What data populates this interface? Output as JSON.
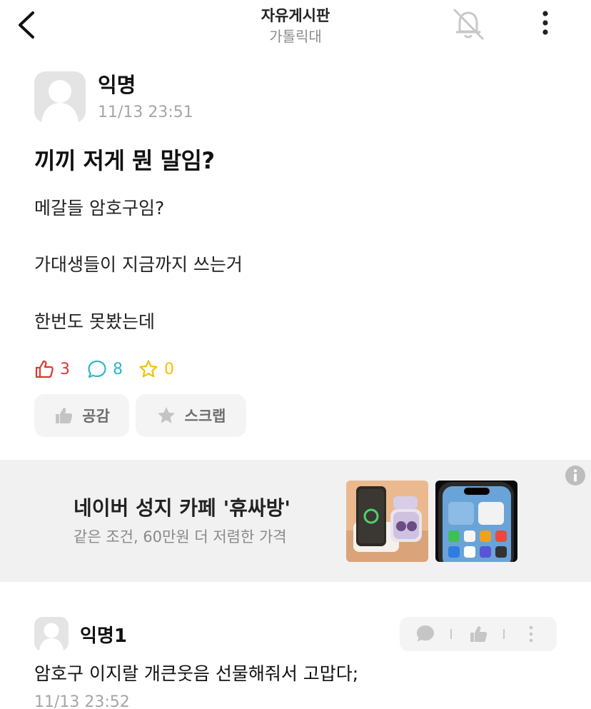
{
  "header": {
    "title": "자유게시판",
    "subtitle": "가톨릭대",
    "back_icon": "chevron-left-icon",
    "notification_icon": "bell-off-icon",
    "more_icon": "more-vertical-icon"
  },
  "post": {
    "author": "익명",
    "time": "11/13 23:51",
    "title": "끼끼 저게 뭔 말임?",
    "body": [
      "메갈들 암호구임?",
      "가대생들이 지금까지 쓰는거",
      "한번도 못봤는데"
    ],
    "stats": {
      "likes": "3",
      "comments": "8",
      "scraps": "0"
    },
    "actions": {
      "like_label": "공감",
      "scrap_label": "스크랩"
    }
  },
  "ad": {
    "title": "네이버 성지 카페 '휴싸방'",
    "subtitle": "같은 조건, 60만원 더 저렴한 가격",
    "info_icon": "info-icon"
  },
  "comments": [
    {
      "author": "익명1",
      "text": "암호구 이지랄 개큰웃음 선물해줘서 고맙다;",
      "time": "11/13 23:52"
    }
  ],
  "colors": {
    "like": "#e2352f",
    "comment": "#2db8c7",
    "scrap": "#f2c300",
    "muted": "#a6a6a6",
    "ad_background": "#f1f1f1"
  }
}
